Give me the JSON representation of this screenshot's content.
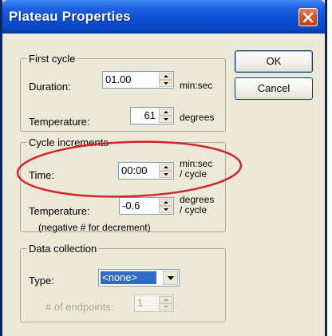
{
  "window": {
    "title": "Plateau Properties",
    "close_icon": "close-icon"
  },
  "buttons": {
    "ok_label": "OK",
    "cancel_label": "Cancel"
  },
  "first_cycle": {
    "legend": "First cycle",
    "duration_label": "Duration:",
    "duration_value": "01.00",
    "duration_unit": "min:sec",
    "temperature_label": "Temperature:",
    "temperature_value": "61",
    "temperature_unit": "degrees"
  },
  "cycle_increments": {
    "legend": "Cycle increments",
    "time_label": "Time:",
    "time_value": "00:00",
    "time_unit_line1": "min:sec",
    "time_unit_line2": "/ cycle",
    "temperature_label": "Temperature:",
    "temperature_value": "-0.6",
    "temperature_unit_line1": "degrees",
    "temperature_unit_line2": "/ cycle",
    "hint": "(negative # for decrement)"
  },
  "data_collection": {
    "legend": "Data collection",
    "type_label": "Type:",
    "type_value": "<none>",
    "endpoints_label": "# of endpoints:",
    "endpoints_value": "1"
  },
  "colors": {
    "titlebar": "#0c4fd4",
    "dialog_bg": "#ece9d8",
    "annotation": "#d6232a",
    "selection": "#316ac5"
  }
}
